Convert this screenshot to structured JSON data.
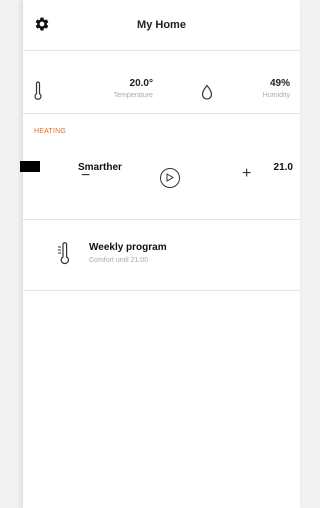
{
  "header": {
    "title": "My Home",
    "settings_icon": "gear-icon"
  },
  "sensors": {
    "temperature": {
      "value": "20.0°",
      "label": "Temperature",
      "icon": "thermometer-icon"
    },
    "humidity": {
      "value": "49%",
      "label": "Humidity",
      "icon": "droplet-icon"
    }
  },
  "heating": {
    "section_label": "HEATING",
    "device": {
      "name": "Smarther",
      "temperature": "21.0"
    },
    "controls": {
      "minus": "−",
      "plus": "+",
      "mode_icon": "play-icon"
    }
  },
  "program": {
    "title": "Weekly program",
    "subtitle": "Comfort until 21:00",
    "icon": "thermostat-program-icon"
  },
  "colors": {
    "accent": "#e86d1f",
    "muted_text": "#aaaaaa",
    "divider": "#e4e4e4"
  }
}
